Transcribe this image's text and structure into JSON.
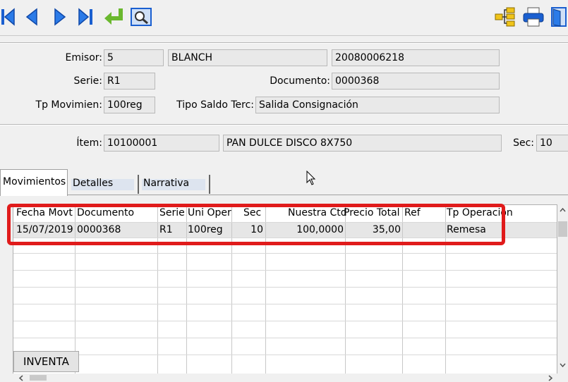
{
  "toolbar": {
    "left_icons": [
      "first-record-icon",
      "previous-record-icon",
      "next-record-icon",
      "last-record-icon",
      "return-icon",
      "preview-icon"
    ],
    "right_icons": [
      "tree-structure-icon",
      "print-icon",
      "exit-door-icon"
    ]
  },
  "header": {
    "emisor_label": "Emisor:",
    "emisor_code": "5",
    "emisor_name": "BLANCH",
    "emisor_id": "20080006218",
    "serie_label": "Serie:",
    "serie_value": "R1",
    "documento_label": "Documento:",
    "documento_value": "0000368",
    "tp_mov_label": "Tp Movimien:",
    "tp_mov_value": "100reg",
    "tipo_saldo_label": "Tipo Saldo Terc:",
    "tipo_saldo_value": "Salida Consignación"
  },
  "item": {
    "item_label": "Ítem:",
    "item_code": "10100001",
    "item_desc": "PAN DULCE DISCO 8X750",
    "sec_label": "Sec:",
    "sec_value": "10"
  },
  "tabs": [
    "Movimientos",
    "Detalles",
    "Narrativa"
  ],
  "grid": {
    "columns": [
      "Fecha Movt",
      "Documento",
      "Serie",
      "Uni Oper",
      "Sec",
      "Nuestra Ctd",
      "Precio Total",
      "Ref",
      "Tp Operación"
    ],
    "rows": [
      [
        "15/07/2019",
        "0000368",
        "R1",
        "100reg",
        "10",
        "100,0000",
        "35,00",
        "",
        "Remesa"
      ]
    ]
  },
  "footer": {
    "inventa_label": "INVENTA"
  },
  "colors": {
    "highlight": "#e01b1b",
    "nav_blue": "#1a5fd0",
    "return_green": "#6ab82e"
  }
}
